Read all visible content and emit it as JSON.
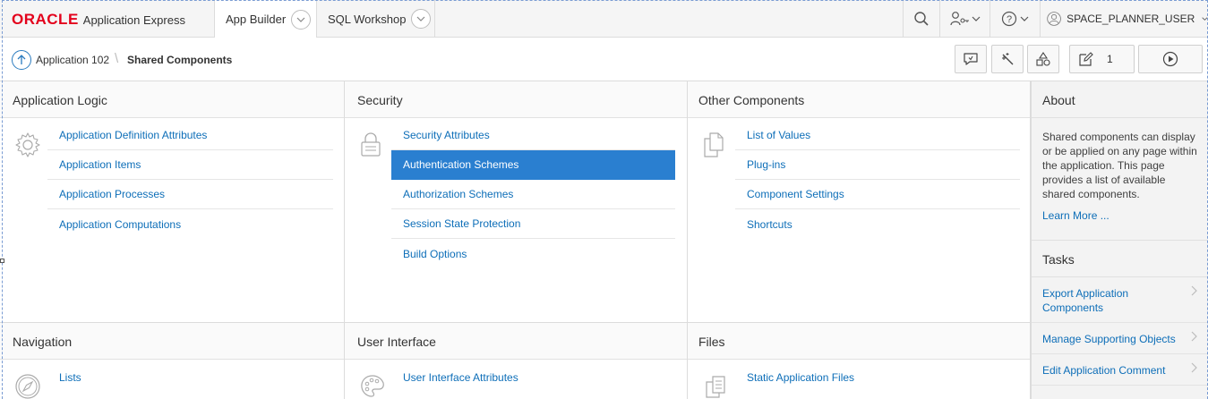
{
  "header": {
    "logo_brand": "ORACLE",
    "logo_product": "Application Express",
    "tabs": [
      {
        "label": "App Builder"
      },
      {
        "label": "SQL Workshop"
      }
    ],
    "user_name": "SPACE_PLANNER_USER"
  },
  "breadcrumb": {
    "parent": "Application 102",
    "separator": "\\",
    "current": "Shared Components"
  },
  "toolbar": {
    "edit_count": "1"
  },
  "regions": {
    "application_logic": {
      "title": "Application Logic",
      "icon": "gear-icon",
      "links": [
        "Application Definition Attributes",
        "Application Items",
        "Application Processes",
        "Application Computations"
      ]
    },
    "security": {
      "title": "Security",
      "icon": "lock-icon",
      "links": [
        "Security Attributes",
        "Authentication Schemes",
        "Authorization Schemes",
        "Session State Protection",
        "Build Options"
      ],
      "selected_index": 1
    },
    "other_components": {
      "title": "Other Components",
      "icon": "copy-files-icon",
      "links": [
        "List of Values",
        "Plug-ins",
        "Component Settings",
        "Shortcuts"
      ]
    },
    "navigation": {
      "title": "Navigation",
      "icon": "compass-icon",
      "links": [
        "Lists"
      ]
    },
    "user_interface": {
      "title": "User Interface",
      "icon": "palette-icon",
      "links": [
        "User Interface Attributes"
      ]
    },
    "files": {
      "title": "Files",
      "icon": "files-icon",
      "links": [
        "Static Application Files"
      ]
    }
  },
  "sidebar": {
    "about_title": "About",
    "about_text": "Shared components can display or be applied on any page within the application. This page provides a list of available shared components.",
    "learn_more": "Learn More ...",
    "tasks_title": "Tasks",
    "tasks": [
      "Export Application Components",
      "Manage Supporting Objects",
      "Edit Application Comment"
    ]
  },
  "colors": {
    "link": "#0d6eb8",
    "selected_bg": "#2a7fd0",
    "brand_red": "#e3001b"
  }
}
